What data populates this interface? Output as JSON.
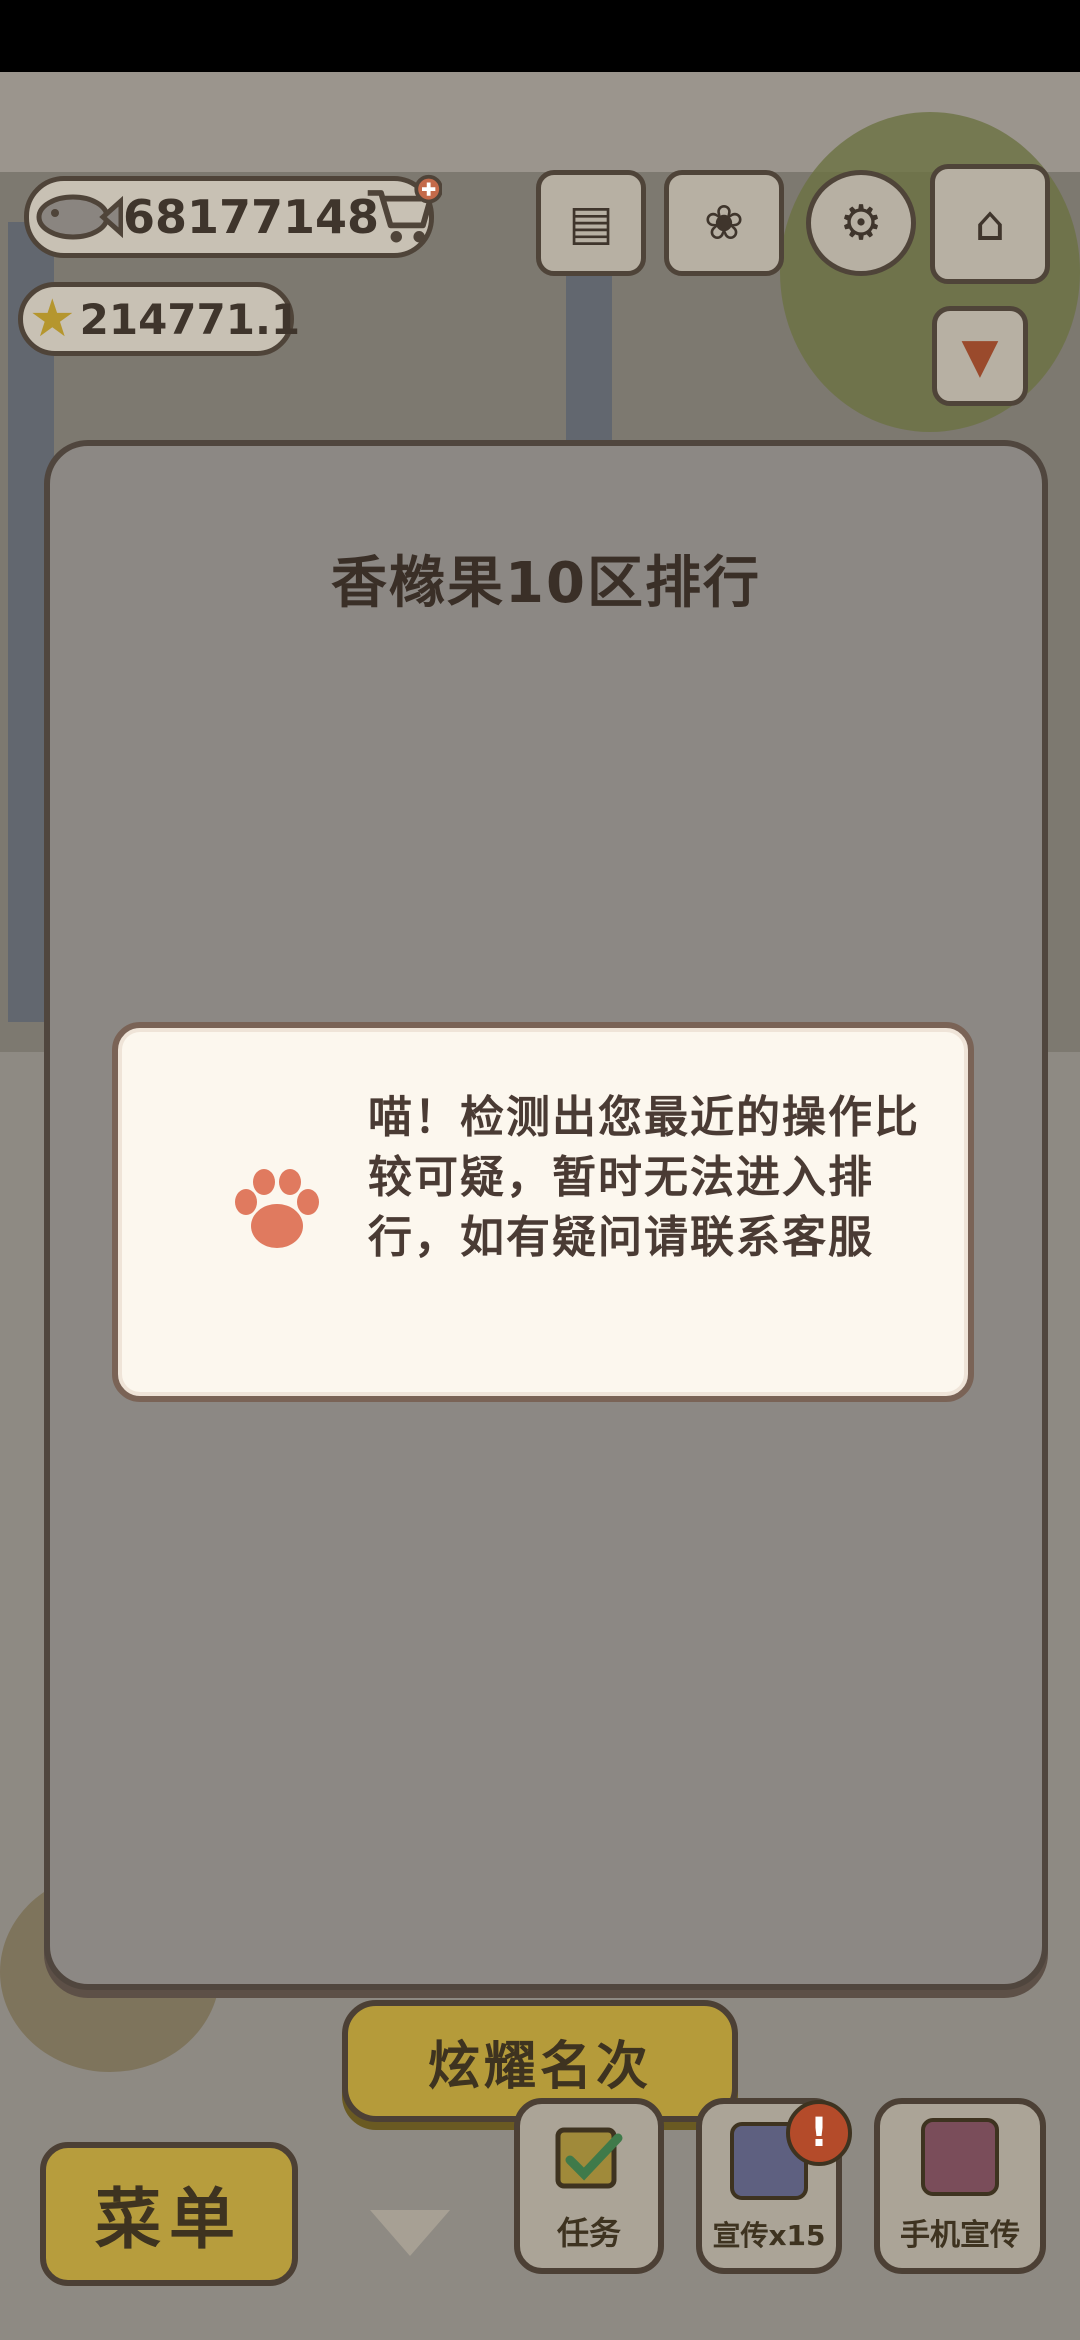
{
  "hud": {
    "fish_count": "68177148",
    "star_count": "214771.1"
  },
  "ranking": {
    "title": "香橼果10区排行",
    "message": "喵！检测出您最近的操作比较可疑，暂时无法进入排行，如有疑问请联系客服"
  },
  "buttons": {
    "show_rank": "炫耀名次",
    "menu": "菜单",
    "tasks": "任务",
    "promote": "宣传x15",
    "phone_promote": "手机宣传",
    "alert_badge": "!"
  },
  "colors": {
    "paw": "#e07a5f",
    "gold_button": "#b59b3a",
    "panel_border": "#50463e"
  }
}
